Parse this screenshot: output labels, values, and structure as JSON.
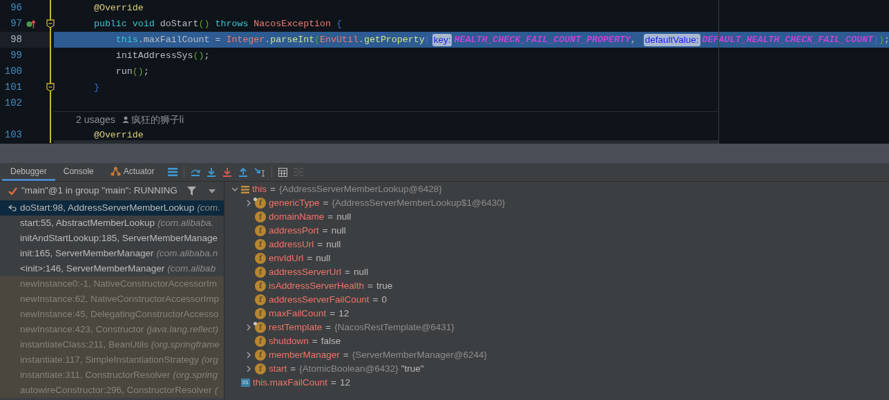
{
  "editor": {
    "lines": [
      {
        "number": "96",
        "highlighted": false,
        "tokens": [
          {
            "kind": "annotation",
            "text": "    @Override"
          }
        ]
      },
      {
        "number": "97",
        "highlighted": false,
        "fold_marker": true,
        "implements_marker": true,
        "tokens": [
          {
            "kind": "keyword",
            "text": "    public void "
          },
          {
            "kind": "plain",
            "text": "doStart"
          },
          {
            "kind": "paren",
            "text": "()"
          },
          {
            "kind": "keyword",
            "text": " throws "
          },
          {
            "kind": "class",
            "text": "NacosException"
          },
          {
            "kind": "brace",
            "text": " {"
          }
        ]
      },
      {
        "number": "98",
        "highlighted": true,
        "tokens": [
          {
            "kind": "keyword",
            "text": "        this"
          },
          {
            "kind": "plain",
            "text": ".maxFailCount = "
          },
          {
            "kind": "class",
            "text": "Integer"
          },
          {
            "kind": "plain",
            "text": "."
          },
          {
            "kind": "method",
            "text": "parseInt"
          },
          {
            "kind": "paren",
            "text": "("
          },
          {
            "kind": "class",
            "text": "EnvUtil"
          },
          {
            "kind": "plain",
            "text": "."
          },
          {
            "kind": "method",
            "text": "getProperty"
          },
          {
            "kind": "brace",
            "text": "("
          },
          {
            "kind": "hint",
            "text": "key:"
          },
          {
            "kind": "constant",
            "text": "HEALTH_CHECK_FAIL_COUNT_PROPERTY"
          },
          {
            "kind": "plain",
            "text": ", "
          },
          {
            "kind": "hint",
            "text": "defaultValue:"
          },
          {
            "kind": "constant",
            "text": "DEFAULT_HEALTH_CHECK_FAIL_COUNT"
          },
          {
            "kind": "brace",
            "text": ")"
          },
          {
            "kind": "paren",
            "text": ")"
          },
          {
            "kind": "plain",
            "text": ";"
          }
        ]
      },
      {
        "number": "99",
        "highlighted": false,
        "tokens": [
          {
            "kind": "plain",
            "text": "        initAddressSys"
          },
          {
            "kind": "paren",
            "text": "()"
          },
          {
            "kind": "plain",
            "text": ";"
          }
        ]
      },
      {
        "number": "100",
        "highlighted": false,
        "tokens": [
          {
            "kind": "plain",
            "text": "        run"
          },
          {
            "kind": "paren",
            "text": "()"
          },
          {
            "kind": "plain",
            "text": ";"
          }
        ]
      },
      {
        "number": "101",
        "highlighted": false,
        "fold_marker": true,
        "tokens": [
          {
            "kind": "brace",
            "text": "    }"
          }
        ]
      },
      {
        "number": "102",
        "highlighted": false
      },
      {
        "usages": "2 usages",
        "author": "疯狂的狮子li"
      },
      {
        "number": "103",
        "highlighted": false,
        "tokens": [
          {
            "kind": "annotation",
            "text": "    @Override"
          }
        ]
      }
    ]
  },
  "debugger": {
    "tabs": [
      {
        "label": "Debugger",
        "selected": true,
        "icon": false
      },
      {
        "label": "Console",
        "selected": false,
        "icon": false
      },
      {
        "label": "Actuator",
        "selected": false,
        "icon": true
      }
    ],
    "thread": "\"main\"@1 in group \"main\": RUNNING",
    "frames": [
      {
        "method": "doStart:98, AddressServerMemberLookup",
        "package": "(com.",
        "selected": true,
        "library": false
      },
      {
        "method": "start:55, AbstractMemberLookup",
        "package": "(com.alibaba.",
        "selected": false,
        "library": false
      },
      {
        "method": "initAndStartLookup:185, ServerMemberManage",
        "selected": false,
        "library": false
      },
      {
        "method": "init:165, ServerMemberManager",
        "package": "(com.alibaba.n",
        "selected": false,
        "library": false
      },
      {
        "method": "<init>:146, ServerMemberManager",
        "package": "(com.alibab",
        "selected": false,
        "library": false
      },
      {
        "method": "newInstance0:-1, NativeConstructorAccessorIm",
        "selected": false,
        "library": true
      },
      {
        "method": "newInstance:62, NativeConstructorAccessorImp",
        "selected": false,
        "library": true
      },
      {
        "method": "newInstance:45, DelegatingConstructorAccesso",
        "selected": false,
        "library": true
      },
      {
        "method": "newInstance:423, Constructor",
        "package": "(java.lang.reflect)",
        "selected": false,
        "library": true
      },
      {
        "method": "instantiateClass:211, BeanUtils",
        "package": "(org.springframe",
        "selected": false,
        "library": true
      },
      {
        "method": "instantiate:117, SimpleInstantiationStrategy",
        "package": "(org",
        "selected": false,
        "library": true
      },
      {
        "method": "instantiate:311, ConstructorResolver",
        "package": "(org.spring",
        "selected": false,
        "library": true
      },
      {
        "method": "autowireConstructor:296, ConstructorResolver",
        "package": "(",
        "selected": false,
        "library": true
      }
    ],
    "variables": [
      {
        "kind": "object",
        "name": "this",
        "separator": "=",
        "expanded": true,
        "value": [
          {
            "kind": "ref",
            "text": "{AddressServerMemberLookup@6428}"
          }
        ],
        "children": [
          {
            "kind": "field",
            "icon_text": "f",
            "name": "genericType",
            "separator": "=",
            "marked": true,
            "expanded": false,
            "value": [
              {
                "kind": "ref",
                "text": "{AddressServerMemberLookup$1@6430}"
              }
            ]
          },
          {
            "kind": "field",
            "icon_text": "f",
            "name": "domainName",
            "separator": "=",
            "value": [
              {
                "kind": "literal",
                "text": "null"
              }
            ]
          },
          {
            "kind": "field",
            "icon_text": "f",
            "name": "addressPort",
            "separator": "=",
            "value": [
              {
                "kind": "literal",
                "text": "null"
              }
            ]
          },
          {
            "kind": "field",
            "icon_text": "f",
            "name": "addressUrl",
            "separator": "=",
            "value": [
              {
                "kind": "literal",
                "text": "null"
              }
            ]
          },
          {
            "kind": "field",
            "icon_text": "f",
            "name": "envIdUrl",
            "separator": "=",
            "value": [
              {
                "kind": "literal",
                "text": "null"
              }
            ]
          },
          {
            "kind": "field",
            "icon_text": "f",
            "name": "addressServerUrl",
            "separator": "=",
            "value": [
              {
                "kind": "literal",
                "text": "null"
              }
            ]
          },
          {
            "kind": "field",
            "icon_text": "f",
            "name": "isAddressServerHealth",
            "separator": "=",
            "value": [
              {
                "kind": "literal",
                "text": "true"
              }
            ]
          },
          {
            "kind": "field",
            "icon_text": "f",
            "name": "addressServerFailCount",
            "separator": "=",
            "value": [
              {
                "kind": "literal",
                "text": "0"
              }
            ]
          },
          {
            "kind": "field",
            "icon_text": "f",
            "name": "maxFailCount",
            "separator": "=",
            "value": [
              {
                "kind": "literal",
                "text": "12"
              }
            ]
          },
          {
            "kind": "field",
            "icon_text": "f",
            "name": "restTemplate",
            "separator": "=",
            "marked": true,
            "expanded": false,
            "value": [
              {
                "kind": "ref",
                "text": "{NacosRestTemplate@6431}"
              }
            ]
          },
          {
            "kind": "field",
            "icon_text": "f",
            "name": "shutdown",
            "separator": "=",
            "value": [
              {
                "kind": "literal",
                "text": "false"
              }
            ]
          },
          {
            "kind": "field",
            "icon_text": "f",
            "name": "memberManager",
            "separator": "=",
            "expanded": false,
            "value": [
              {
                "kind": "ref",
                "text": "{ServerMemberManager@6244}"
              }
            ]
          },
          {
            "kind": "field",
            "icon_text": "f",
            "name": "start",
            "separator": "=",
            "expanded": false,
            "value": [
              {
                "kind": "ref",
                "text": "{AtomicBoolean@6432}"
              },
              {
                "kind": "literal",
                "text": "\"true\""
              }
            ]
          }
        ]
      },
      {
        "kind": "watch",
        "icon_text": "01",
        "name": "this.maxFailCount",
        "separator": "=",
        "value": [
          {
            "kind": "literal",
            "text": "12"
          }
        ]
      }
    ]
  }
}
